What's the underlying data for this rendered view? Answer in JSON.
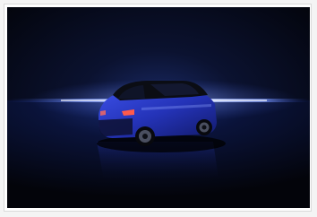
{
  "photo": {
    "subject": "car-photo",
    "colors": {
      "background": "#05060b",
      "horizon_glow": "#6f8dff",
      "car_body": "#2736c9",
      "car_roof": "#0b0d14",
      "frame": "#ffffff"
    }
  }
}
